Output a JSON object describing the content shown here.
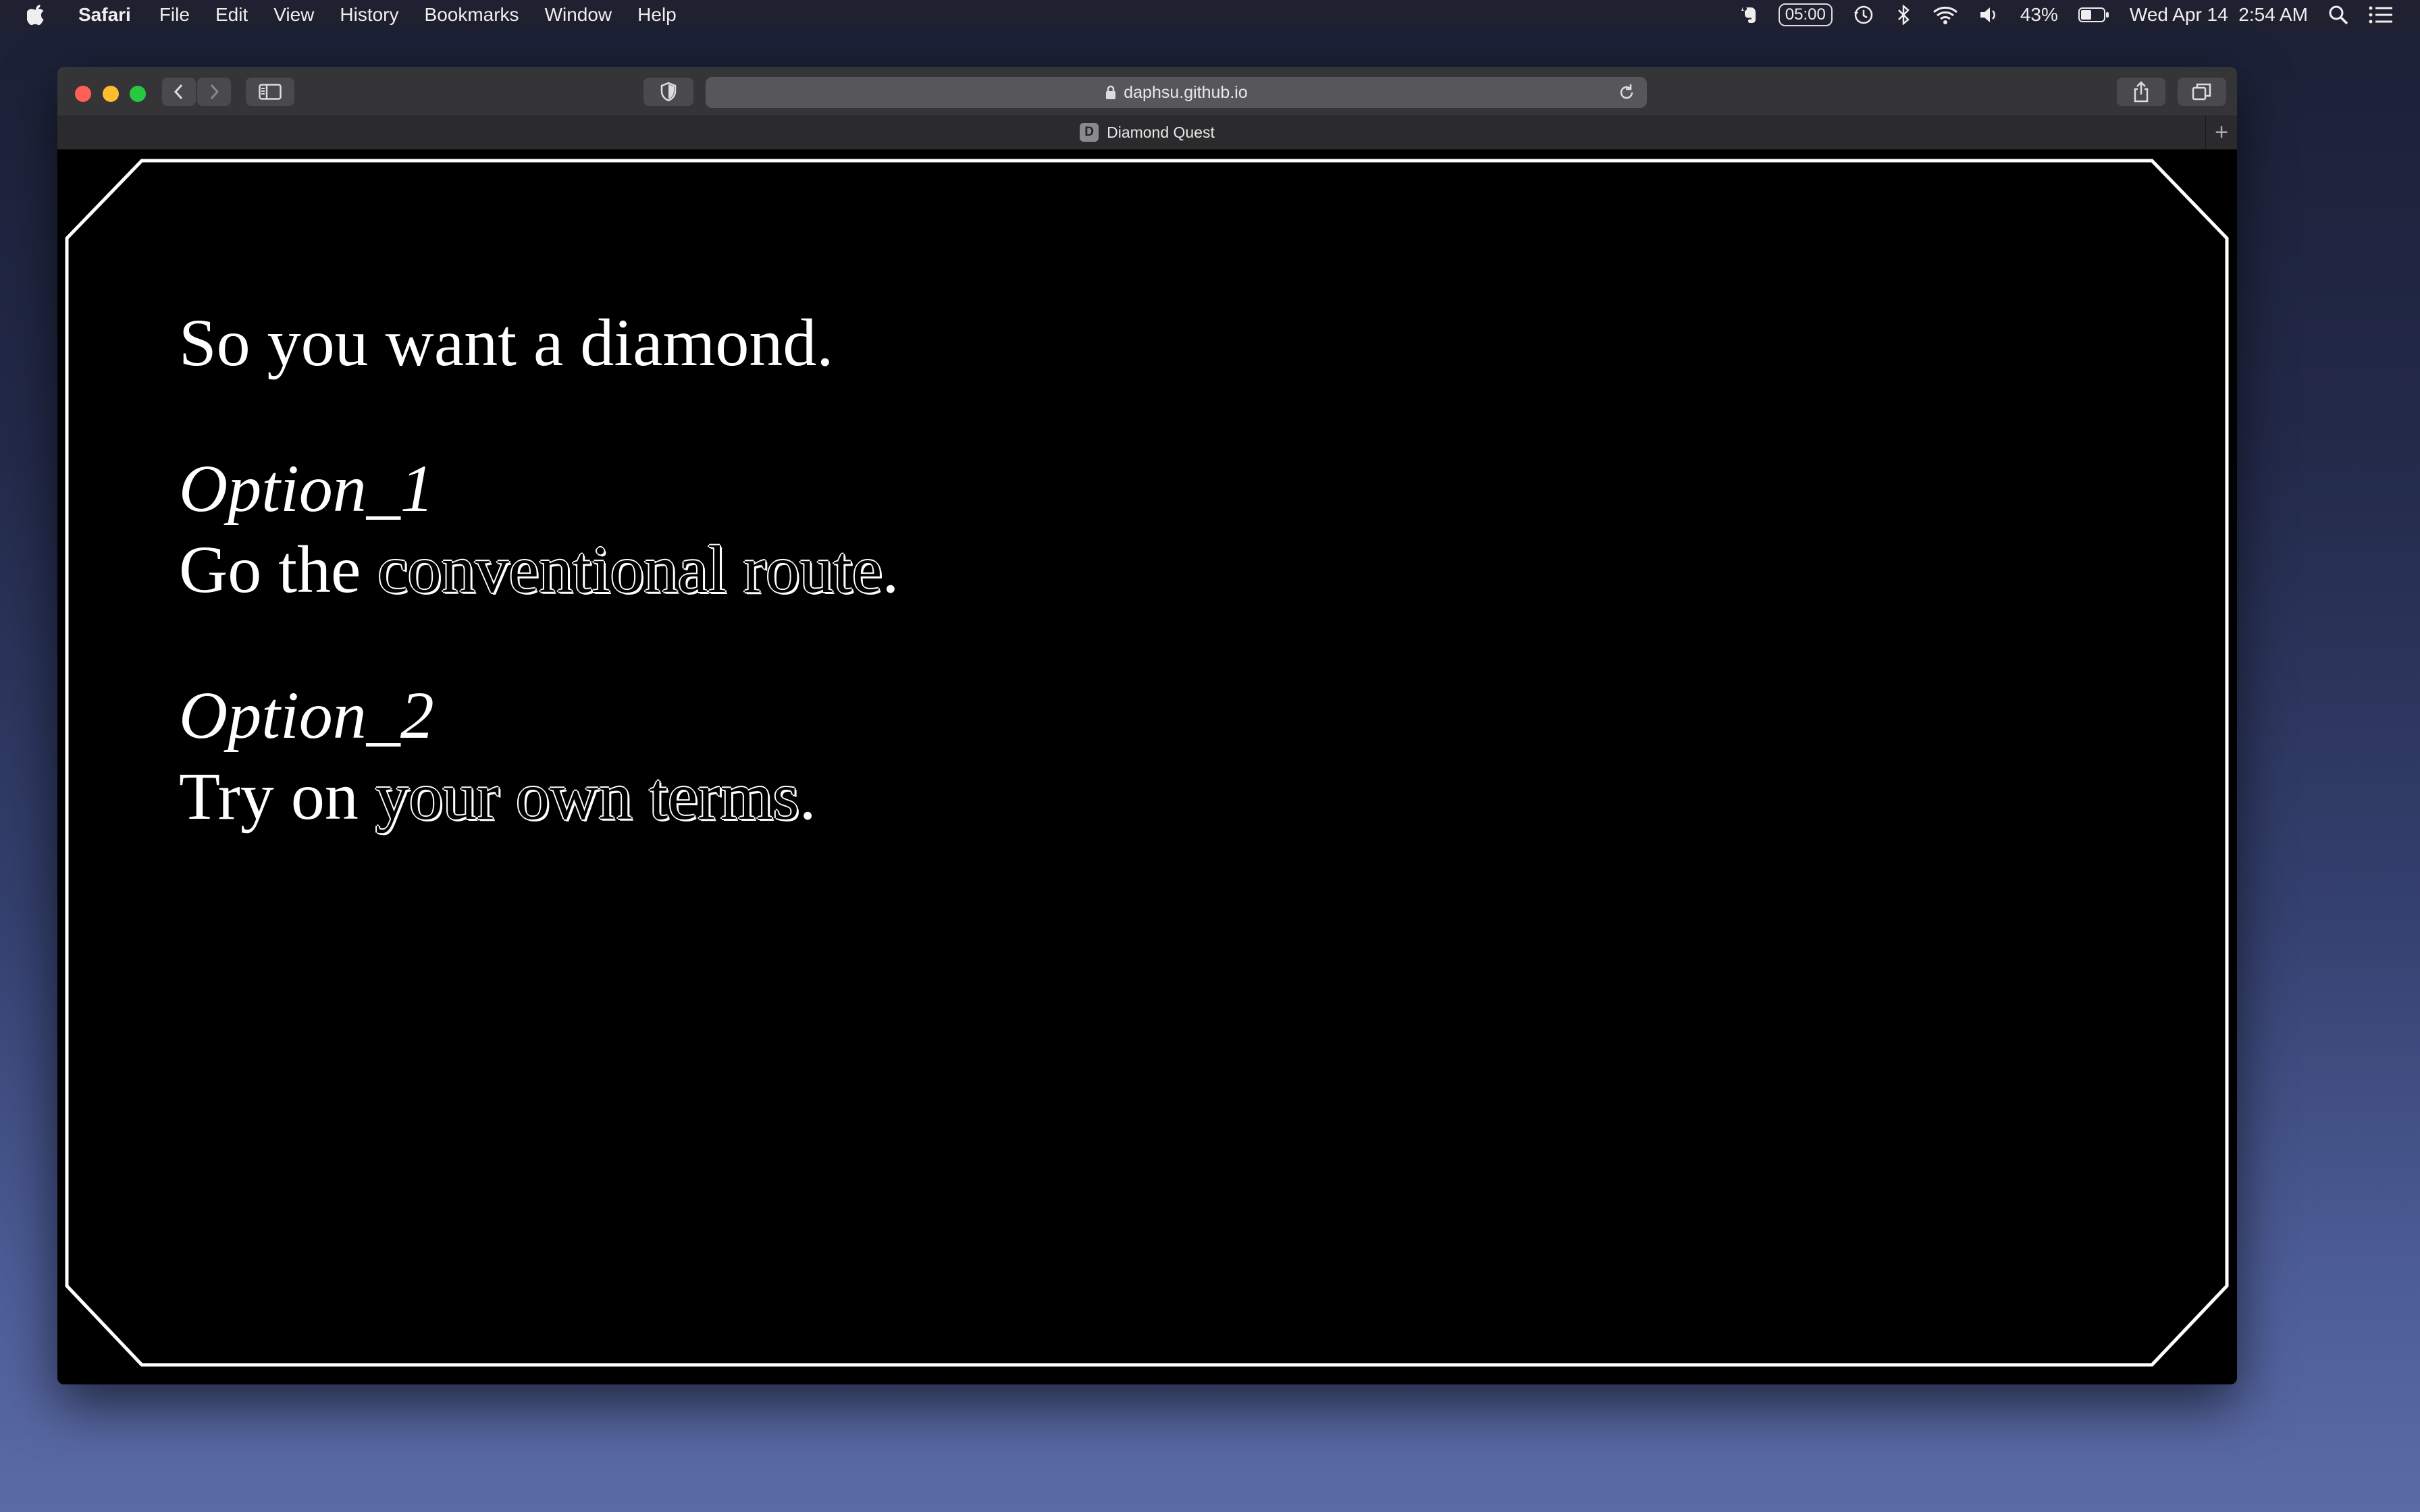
{
  "menubar": {
    "app_name": "Safari",
    "items": [
      "File",
      "Edit",
      "View",
      "History",
      "Bookmarks",
      "Window",
      "Help"
    ],
    "timer": "05:00",
    "battery": "43%",
    "datetime": "Wed Apr 14  2:54 AM"
  },
  "browser": {
    "url": "daphsu.github.io",
    "tab_title": "Diamond Quest",
    "favicon_letter": "D"
  },
  "page": {
    "heading": "So you want a diamond.",
    "option1": {
      "label": "Option_1",
      "prefix": "Go the ",
      "link": "conventional route",
      "suffix": "."
    },
    "option2": {
      "label": "Option_2",
      "prefix": "Try on ",
      "link": "your own terms",
      "suffix": "."
    }
  },
  "colors": {
    "page_background": "#000000",
    "frame_stroke": "#ffffff",
    "text": "#ffffff"
  }
}
